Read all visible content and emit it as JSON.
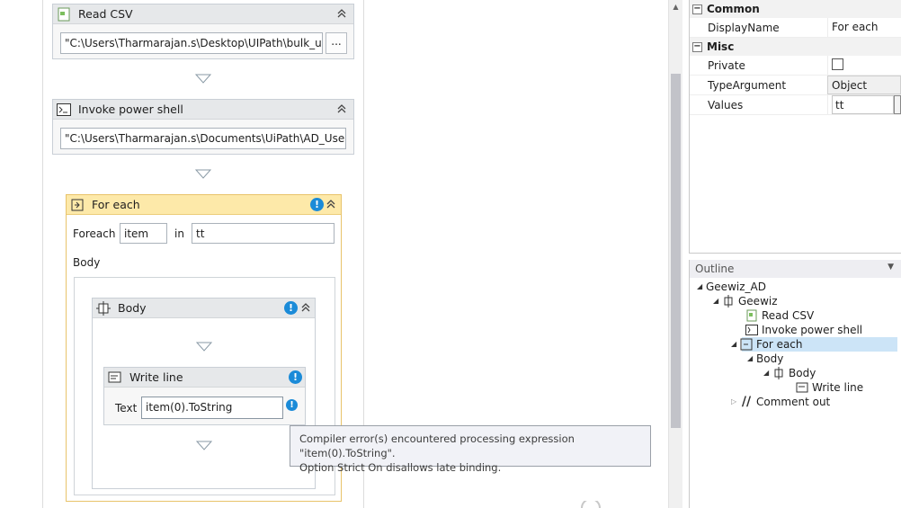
{
  "activities": {
    "read_csv": {
      "title": "Read CSV",
      "path": "\"C:\\Users\\Tharmarajan.s\\Desktop\\UIPath\\bulk_use",
      "browse": "..."
    },
    "invoke_ps": {
      "title": "Invoke power shell",
      "path": "\"C:\\Users\\Tharmarajan.s\\Documents\\UiPath\\AD_User_("
    },
    "foreach": {
      "title": "For each",
      "foreach_label": "Foreach",
      "item_var": "item",
      "in_label": "in",
      "collection": "tt",
      "body_label": "Body"
    },
    "body": {
      "title": "Body"
    },
    "write_line": {
      "title": "Write line",
      "text_label": "Text",
      "text_value": "item(0).ToString"
    }
  },
  "tooltip": {
    "line1": "Compiler error(s) encountered processing expression \"item(0).ToString\".",
    "line2": "Option Strict On disallows late binding."
  },
  "properties": {
    "common": {
      "label": "Common",
      "display_name_label": "DisplayName",
      "display_name_value": "For each"
    },
    "misc": {
      "label": "Misc",
      "private_label": "Private",
      "type_arg_label": "TypeArgument",
      "type_arg_value": "Object",
      "values_label": "Values",
      "values_value": "tt"
    }
  },
  "outline": {
    "title": "Outline",
    "items": [
      "Geewiz_AD",
      "Geewiz",
      "Read CSV",
      "Invoke power shell",
      "For each",
      "Body",
      "Body",
      "Write line",
      "Comment out"
    ]
  },
  "colors": {
    "selected_row": "#cce4f7",
    "warning": "#1b8bd8",
    "foreach_header": "#fde9a9"
  }
}
